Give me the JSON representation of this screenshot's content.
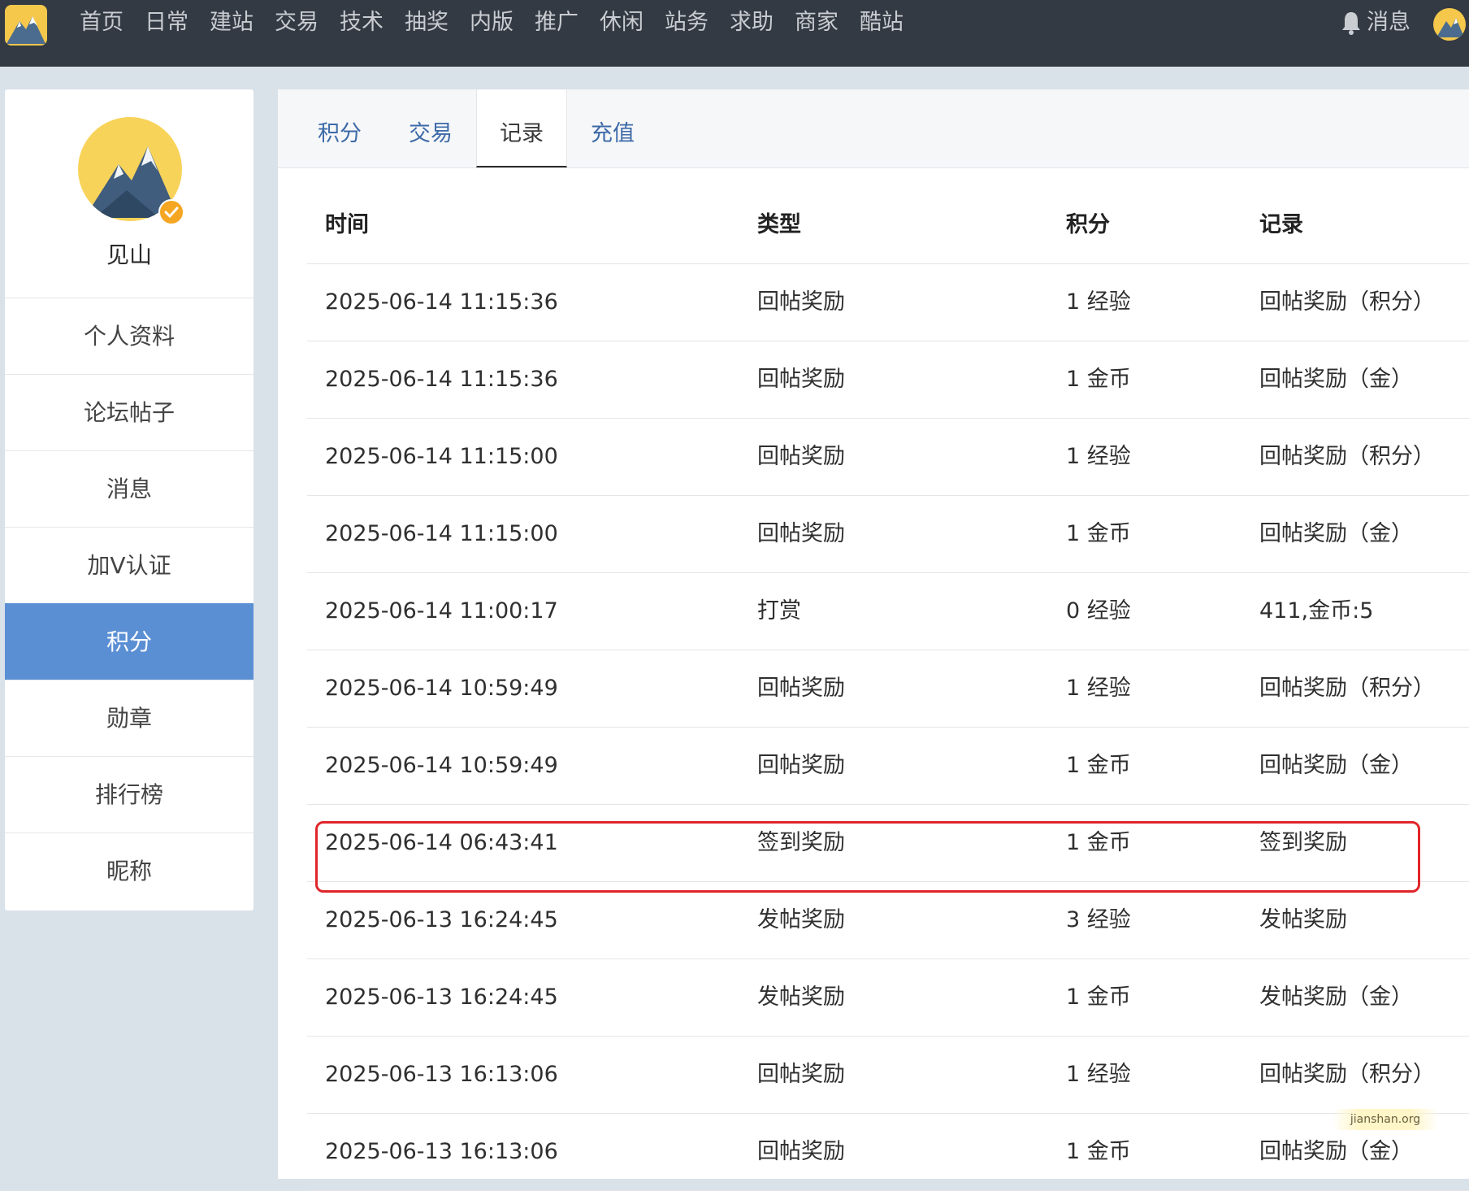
{
  "nav": {
    "items": [
      "首页",
      "日常",
      "建站",
      "交易",
      "技术",
      "抽奖",
      "内版",
      "推广",
      "休闲",
      "站务",
      "求助",
      "商家",
      "酷站"
    ],
    "messages_label": "消息"
  },
  "profile": {
    "username": "见山"
  },
  "side_menu": {
    "items": [
      {
        "label": "个人资料",
        "active": false
      },
      {
        "label": "论坛帖子",
        "active": false
      },
      {
        "label": "消息",
        "active": false
      },
      {
        "label": "加V认证",
        "active": false
      },
      {
        "label": "积分",
        "active": true
      },
      {
        "label": "勋章",
        "active": false
      },
      {
        "label": "排行榜",
        "active": false
      },
      {
        "label": "昵称",
        "active": false
      }
    ]
  },
  "tabs": {
    "items": [
      {
        "label": "积分",
        "active": false
      },
      {
        "label": "交易",
        "active": false
      },
      {
        "label": "记录",
        "active": true
      },
      {
        "label": "充值",
        "active": false
      }
    ]
  },
  "table": {
    "headers": [
      "时间",
      "类型",
      "积分",
      "记录"
    ],
    "rows": [
      [
        "2025-06-14 11:15:36",
        "回帖奖励",
        "1 经验",
        "回帖奖励（积分）"
      ],
      [
        "2025-06-14 11:15:36",
        "回帖奖励",
        "1 金币",
        "回帖奖励（金）"
      ],
      [
        "2025-06-14 11:15:00",
        "回帖奖励",
        "1 经验",
        "回帖奖励（积分）"
      ],
      [
        "2025-06-14 11:15:00",
        "回帖奖励",
        "1 金币",
        "回帖奖励（金）"
      ],
      [
        "2025-06-14 11:00:17",
        "打赏",
        "0 经验",
        "411,金币:5"
      ],
      [
        "2025-06-14 10:59:49",
        "回帖奖励",
        "1 经验",
        "回帖奖励（积分）"
      ],
      [
        "2025-06-14 10:59:49",
        "回帖奖励",
        "1 金币",
        "回帖奖励（金）"
      ],
      [
        "2025-06-14 06:43:41",
        "签到奖励",
        "1 金币",
        "签到奖励"
      ],
      [
        "2025-06-13 16:24:45",
        "发帖奖励",
        "3 经验",
        "发帖奖励"
      ],
      [
        "2025-06-13 16:24:45",
        "发帖奖励",
        "1 金币",
        "发帖奖励（金）"
      ],
      [
        "2025-06-13 16:13:06",
        "回帖奖励",
        "1 经验",
        "回帖奖励（积分）"
      ],
      [
        "2025-06-13 16:13:06",
        "回帖奖励",
        "1 金币",
        "回帖奖励（金）"
      ]
    ]
  },
  "watermark": "jianshan.org",
  "colors": {
    "topbar": "#343a43",
    "active_menu": "#5b8fd4",
    "tab_link": "#3d6aa8",
    "highlight_border": "#e0262b",
    "verify_badge": "#f5a623"
  },
  "icons": {
    "logo": "mountain-logo-icon",
    "bell": "bell-icon",
    "verify": "verified-badge-icon"
  }
}
